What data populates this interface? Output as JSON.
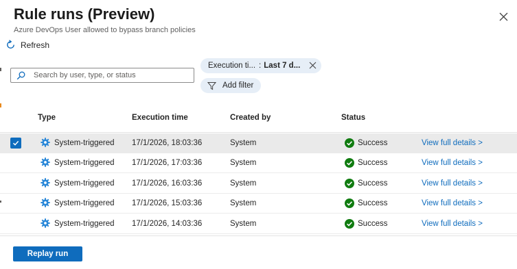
{
  "panel": {
    "title": "Rule runs (Preview)",
    "subtitle": "Azure DevOps User allowed to bypass branch policies"
  },
  "toolbar": {
    "refresh_label": "Refresh"
  },
  "search": {
    "placeholder": "Search by user, type, or status"
  },
  "filters": {
    "active": {
      "name": "Execution ti...",
      "separator": ":",
      "value": "Last 7 d..."
    },
    "add_label": "Add filter"
  },
  "table": {
    "columns": [
      "Type",
      "Execution time",
      "Created by",
      "Status"
    ],
    "rows": [
      {
        "type": "System-triggered",
        "time": "17/1/2026, 18:03:36",
        "created_by": "System",
        "status": "Success",
        "link": "View full details >",
        "selected": true
      },
      {
        "type": "System-triggered",
        "time": "17/1/2026, 17:03:36",
        "created_by": "System",
        "status": "Success",
        "link": "View full details >",
        "selected": false
      },
      {
        "type": "System-triggered",
        "time": "17/1/2026, 16:03:36",
        "created_by": "System",
        "status": "Success",
        "link": "View full details >",
        "selected": false
      },
      {
        "type": "System-triggered",
        "time": "17/1/2026, 15:03:36",
        "created_by": "System",
        "status": "Success",
        "link": "View full details >",
        "selected": false
      },
      {
        "type": "System-triggered",
        "time": "17/1/2026, 14:03:36",
        "created_by": "System",
        "status": "Success",
        "link": "View full details >",
        "selected": false
      }
    ]
  },
  "footer": {
    "replay_label": "Replay run"
  },
  "icons": {
    "close": "close-icon",
    "refresh": "refresh-icon",
    "search": "search-icon",
    "filter": "filter-icon",
    "dismiss": "dismiss-icon",
    "check": "checkmark-icon",
    "type": "gear-icon",
    "status": "success-check-circle-icon"
  },
  "colors": {
    "accent": "#0f6cbd",
    "success": "#107c10",
    "pill": "#e6eef7",
    "selected_row": "#eaeaea"
  }
}
